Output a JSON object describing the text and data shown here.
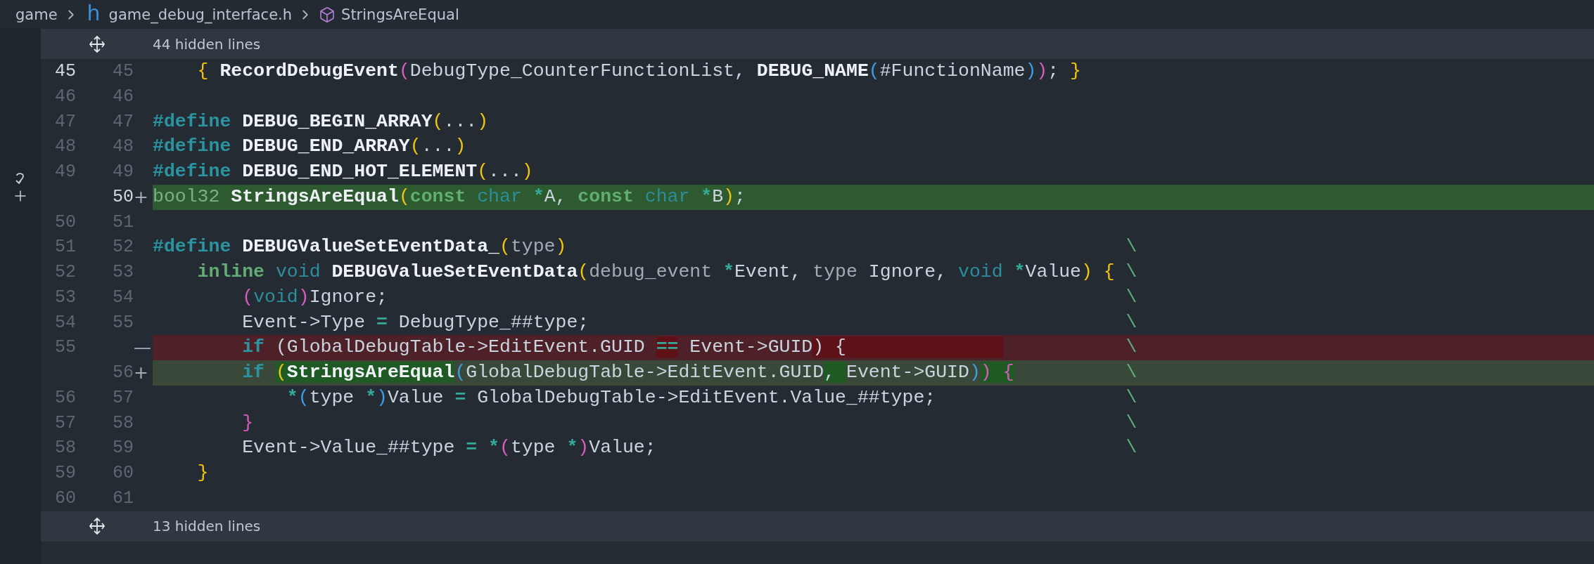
{
  "breadcrumb": [
    {
      "kind": "folder",
      "label": "game"
    },
    {
      "kind": "file",
      "icon": "h",
      "label": "game_debug_interface.h"
    },
    {
      "kind": "symbol",
      "label": "StringsAreEqual"
    }
  ],
  "hidden_top": "44 hidden lines",
  "lines": [
    {
      "kind": "context",
      "old": "45",
      "new": "45",
      "current": true,
      "segments": [
        {
          "text": "    {",
          "kind": "p1"
        },
        {
          "text": " RecordDebugEvent",
          "kind": "fn"
        },
        {
          "text": "(",
          "kind": "p2"
        },
        {
          "text": "DebugType_CounterFunctionList, ",
          "kind": "plain"
        },
        {
          "text": "DEBUG_NAME",
          "kind": "fn"
        },
        {
          "text": "(",
          "kind": "p3"
        },
        {
          "text": "#FunctionName",
          "kind": "plain"
        },
        {
          "text": ")",
          "kind": "p3"
        },
        {
          "text": ")",
          "kind": "p2"
        },
        {
          "text": "; ",
          "kind": "plain"
        },
        {
          "text": "}",
          "kind": "p1"
        }
      ]
    },
    {
      "kind": "context",
      "old": "46",
      "new": "46"
    },
    {
      "kind": "context",
      "old": "47",
      "new": "47",
      "segments": [
        {
          "text": "#define",
          "kind": "kw"
        },
        {
          "text": " DEBUG_BEGIN_ARRAY",
          "kind": "fn"
        },
        {
          "text": "(",
          "kind": "p1"
        },
        {
          "text": "...",
          "kind": "plain"
        },
        {
          "text": ")",
          "kind": "p1"
        }
      ]
    },
    {
      "kind": "context",
      "old": "48",
      "new": "48",
      "segments": [
        {
          "text": "#define",
          "kind": "kw"
        },
        {
          "text": " DEBUG_END_ARRAY",
          "kind": "fn"
        },
        {
          "text": "(",
          "kind": "p1"
        },
        {
          "text": "...",
          "kind": "plain"
        },
        {
          "text": ")",
          "kind": "p1"
        }
      ]
    },
    {
      "kind": "context",
      "old": "49",
      "new": "49",
      "segments": [
        {
          "text": "#define",
          "kind": "kw"
        },
        {
          "text": " DEBUG_END_HOT_ELEMENT",
          "kind": "fn"
        },
        {
          "text": "(",
          "kind": "p1"
        },
        {
          "text": "...",
          "kind": "plain"
        },
        {
          "text": ")",
          "kind": "p1"
        }
      ]
    },
    {
      "kind": "inserted",
      "new": "50",
      "marker": "+",
      "hovered": true,
      "segments": [
        {
          "text": "bool32",
          "kind": "kw3"
        },
        {
          "text": " StringsAreEqual",
          "kind": "fn"
        },
        {
          "text": "(",
          "kind": "p1"
        },
        {
          "text": "const",
          "kind": "kw2"
        },
        {
          "text": " char",
          "kind": "type"
        },
        {
          "text": " *",
          "kind": "op"
        },
        {
          "text": "A, ",
          "kind": "plain"
        },
        {
          "text": "const",
          "kind": "kw2"
        },
        {
          "text": " char",
          "kind": "type"
        },
        {
          "text": " *",
          "kind": "op"
        },
        {
          "text": "B",
          "kind": "plain"
        },
        {
          "text": ")",
          "kind": "p1"
        },
        {
          "text": ";",
          "kind": "plain"
        }
      ]
    },
    {
      "kind": "context",
      "old": "50",
      "new": "51"
    },
    {
      "kind": "context",
      "old": "51",
      "new": "52",
      "continuation": "\\",
      "segments": [
        {
          "text": "#define",
          "kind": "kw"
        },
        {
          "text": " DEBUGValueSetEventData_",
          "kind": "fn"
        },
        {
          "text": "(",
          "kind": "p1"
        },
        {
          "text": "type",
          "kind": "dim"
        },
        {
          "text": ")",
          "kind": "p1"
        }
      ]
    },
    {
      "kind": "context",
      "old": "52",
      "new": "53",
      "continuation": "\\",
      "segments": [
        {
          "text": "    inline",
          "kind": "kw2"
        },
        {
          "text": " void",
          "kind": "type"
        },
        {
          "text": " DEBUGValueSetEventData",
          "kind": "fn"
        },
        {
          "text": "(",
          "kind": "p1"
        },
        {
          "text": "debug_event",
          "kind": "dim"
        },
        {
          "text": " *",
          "kind": "op"
        },
        {
          "text": "Event, ",
          "kind": "plain"
        },
        {
          "text": "type",
          "kind": "dim"
        },
        {
          "text": " Ignore, ",
          "kind": "plain"
        },
        {
          "text": "void",
          "kind": "type"
        },
        {
          "text": " *",
          "kind": "op"
        },
        {
          "text": "Value",
          "kind": "plain"
        },
        {
          "text": ")",
          "kind": "p1"
        },
        {
          "text": " {",
          "kind": "p1"
        }
      ]
    },
    {
      "kind": "context",
      "old": "53",
      "new": "54",
      "continuation": "\\",
      "segments": [
        {
          "text": "        (",
          "kind": "p2"
        },
        {
          "text": "void",
          "kind": "type"
        },
        {
          "text": ")",
          "kind": "p2"
        },
        {
          "text": "Ignore;",
          "kind": "plain"
        }
      ]
    },
    {
      "kind": "context",
      "old": "54",
      "new": "55",
      "continuation": "\\",
      "segments": [
        {
          "text": "        Event->Type ",
          "kind": "plain"
        },
        {
          "text": "=",
          "kind": "op"
        },
        {
          "text": " DebugType_##type;",
          "kind": "plain"
        }
      ]
    },
    {
      "kind": "removed",
      "old": "55",
      "marker": "—",
      "continuation": "\\",
      "segments": [
        {
          "text": "        if",
          "kind": "kw"
        },
        {
          "text": " (GlobalDebugTable->EditEvent.GUID ",
          "kind": "plain"
        },
        {
          "text": "==",
          "kind": "op",
          "hl": true
        },
        {
          "text": " Event->GUID",
          "kind": "plain"
        },
        {
          "text": ") {              ",
          "kind": "plain",
          "hl": true
        }
      ]
    },
    {
      "kind": "added",
      "new": "56",
      "marker": "+",
      "continuation": "\\",
      "segments": [
        {
          "text": "        if ",
          "kind": "kw"
        },
        {
          "text": "(",
          "kind": "p1",
          "hl": true
        },
        {
          "text": "StringsAreEqual",
          "kind": "fn",
          "hl": true
        },
        {
          "text": "(",
          "kind": "p3"
        },
        {
          "text": "GlobalDebugTable->EditEvent.GUID",
          "kind": "plain"
        },
        {
          "text": ", ",
          "kind": "plain",
          "hl": true
        },
        {
          "text": "Event->GUID",
          "kind": "plain"
        },
        {
          "text": ")",
          "kind": "p3"
        },
        {
          "text": ") {",
          "kind": "p2",
          "hl": true
        }
      ]
    },
    {
      "kind": "context",
      "old": "56",
      "new": "57",
      "continuation": "\\",
      "segments": [
        {
          "text": "            *",
          "kind": "op"
        },
        {
          "text": "(",
          "kind": "p3"
        },
        {
          "text": "type ",
          "kind": "plain"
        },
        {
          "text": "*",
          "kind": "op"
        },
        {
          "text": ")",
          "kind": "p3"
        },
        {
          "text": "Value ",
          "kind": "plain"
        },
        {
          "text": "=",
          "kind": "op"
        },
        {
          "text": " GlobalDebugTable->EditEvent.Value_##type;",
          "kind": "plain"
        }
      ]
    },
    {
      "kind": "context",
      "old": "57",
      "new": "58",
      "continuation": "\\",
      "segments": [
        {
          "text": "        }",
          "kind": "p2"
        }
      ]
    },
    {
      "kind": "context",
      "old": "58",
      "new": "59",
      "continuation": "\\",
      "segments": [
        {
          "text": "        Event->Value_##type ",
          "kind": "plain"
        },
        {
          "text": "=",
          "kind": "op"
        },
        {
          "text": " *",
          "kind": "op"
        },
        {
          "text": "(",
          "kind": "p2"
        },
        {
          "text": "type ",
          "kind": "plain"
        },
        {
          "text": "*",
          "kind": "op"
        },
        {
          "text": ")",
          "kind": "p2"
        },
        {
          "text": "Value;",
          "kind": "plain"
        }
      ]
    },
    {
      "kind": "context",
      "old": "59",
      "new": "60",
      "segments": [
        {
          "text": "    }",
          "kind": "p1"
        }
      ]
    },
    {
      "kind": "context",
      "old": "60",
      "new": "61"
    }
  ],
  "hidden_bottom": "13 hidden lines"
}
